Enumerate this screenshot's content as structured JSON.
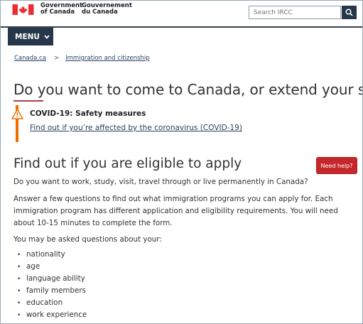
{
  "header": {
    "goc_en_line1": "Government",
    "goc_en_line2": "of Canada",
    "goc_fr_line1": "Gouvernement",
    "goc_fr_line2": "du Canada",
    "search_placeholder": "Search IRCC",
    "search_icon": "search-icon",
    "flag_color": "#eb2d37"
  },
  "nav": {
    "menu_label": "MENU"
  },
  "breadcrumb": {
    "items": [
      "Canada.ca",
      "Immigration and citizenship"
    ],
    "separator": ">"
  },
  "page": {
    "title": "Do you want to come to Canada, or extend your stay?"
  },
  "alert": {
    "title": "COVID-19: Safety measures",
    "link": "Find out if you’re affected by the coronavirus (COVID-19)",
    "color": "#ee7100"
  },
  "section": {
    "heading": "Find out if you are eligible to apply",
    "help_button": "Need help?",
    "intro": "Do you want to work, study, visit, travel through or live permanently in Canada?",
    "description": "Answer a few questions to find out what immigration programs you can apply for. Each immigration program has different application and eligibility requirements. You will need about 10-15 minutes to complete the form.",
    "questions_intro": "You may be asked questions about your:",
    "questions": [
      "nationality",
      "age",
      "language ability",
      "family members",
      "education",
      "work experience"
    ]
  },
  "colors": {
    "nav_dark": "#26374a",
    "link": "#284162",
    "accent_red": "#af3c43",
    "help_red": "#c5272b"
  }
}
